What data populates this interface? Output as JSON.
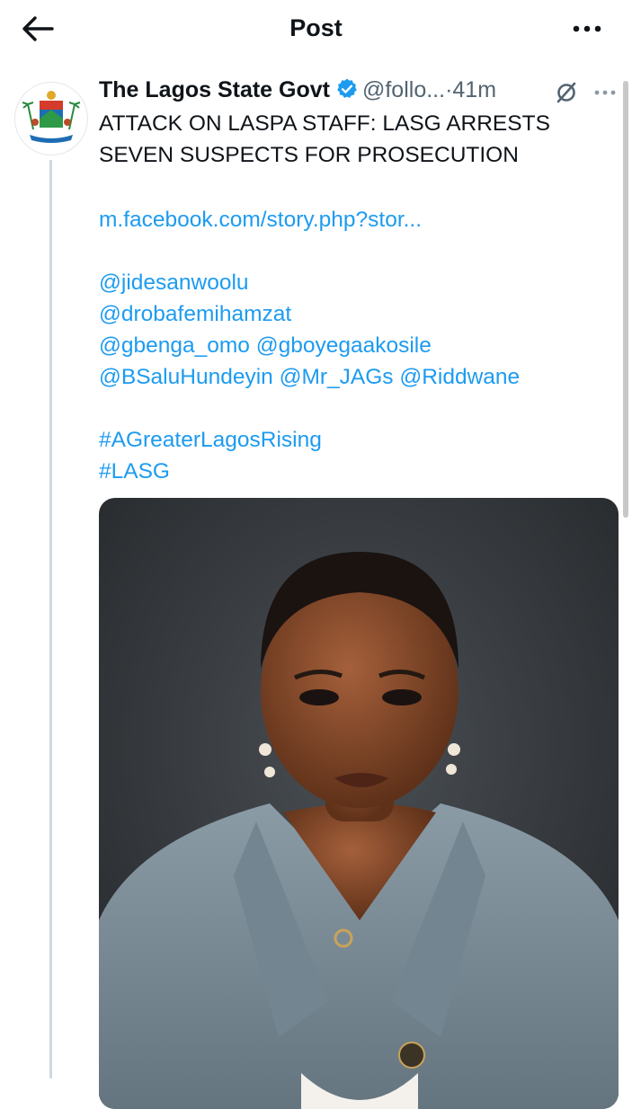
{
  "header": {
    "title": "Post"
  },
  "post": {
    "author_name": "The Lagos State Govt",
    "handle": "@follo...",
    "separator": "·",
    "time": "41m",
    "headline_lines": [
      "ATTACK ON LASPA STAFF: LASG ARRESTS",
      "SEVEN SUSPECTS FOR PROSECUTION"
    ],
    "link": "m.facebook.com/story.php?stor...",
    "mentions_lines": [
      "@jidesanwoolu",
      "@drobafemihamzat",
      "@gbenga_omo @gboyegaakosile",
      "@BSaluHundeyin @Mr_JAGs @Riddwane"
    ],
    "hashtags": [
      "#AGreaterLagosRising",
      "#LASG"
    ],
    "media_alt": "Portrait photo of a woman in a grey-blue blazer"
  },
  "colors": {
    "accent": "#1d9bf0",
    "text": "#0f1419",
    "muted": "#536471"
  },
  "icons": {
    "back": "arrow-left-icon",
    "more": "more-horizontal-icon",
    "verified": "verified-badge-icon",
    "grok": "grok-icon"
  }
}
